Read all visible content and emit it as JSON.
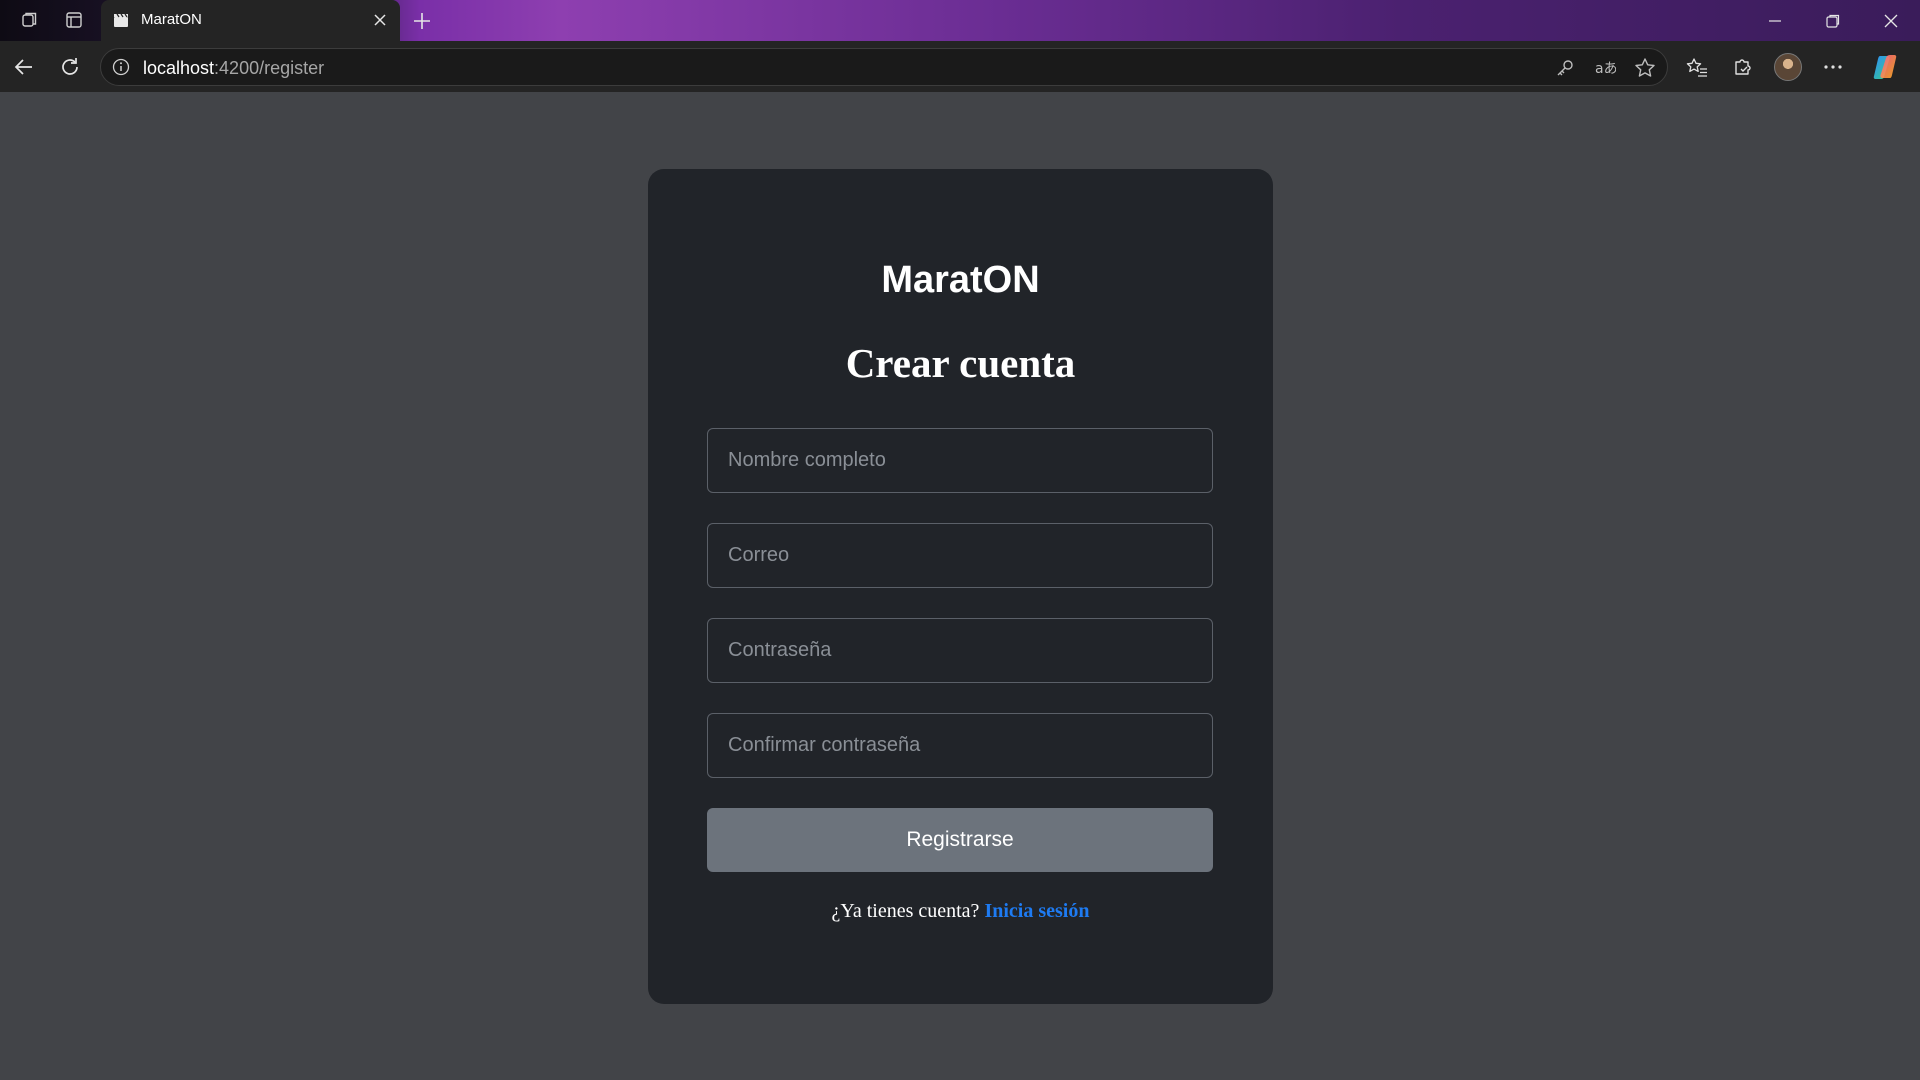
{
  "browser": {
    "tab_title": "MaratON",
    "url_host": "localhost",
    "url_path": ":4200/register"
  },
  "page": {
    "brand": "MaratON",
    "heading": "Crear cuenta",
    "fields": {
      "full_name_placeholder": "Nombre completo",
      "email_placeholder": "Correo",
      "password_placeholder": "Contraseña",
      "confirm_password_placeholder": "Confirmar contraseña"
    },
    "submit_label": "Registrarse",
    "footer_prompt": "¿Ya tienes cuenta?",
    "footer_link": "Inicia sesión"
  },
  "colors": {
    "page_background": "#424448",
    "card_background": "#212429",
    "button_background": "#6c737c",
    "link": "#1e7bf2"
  }
}
